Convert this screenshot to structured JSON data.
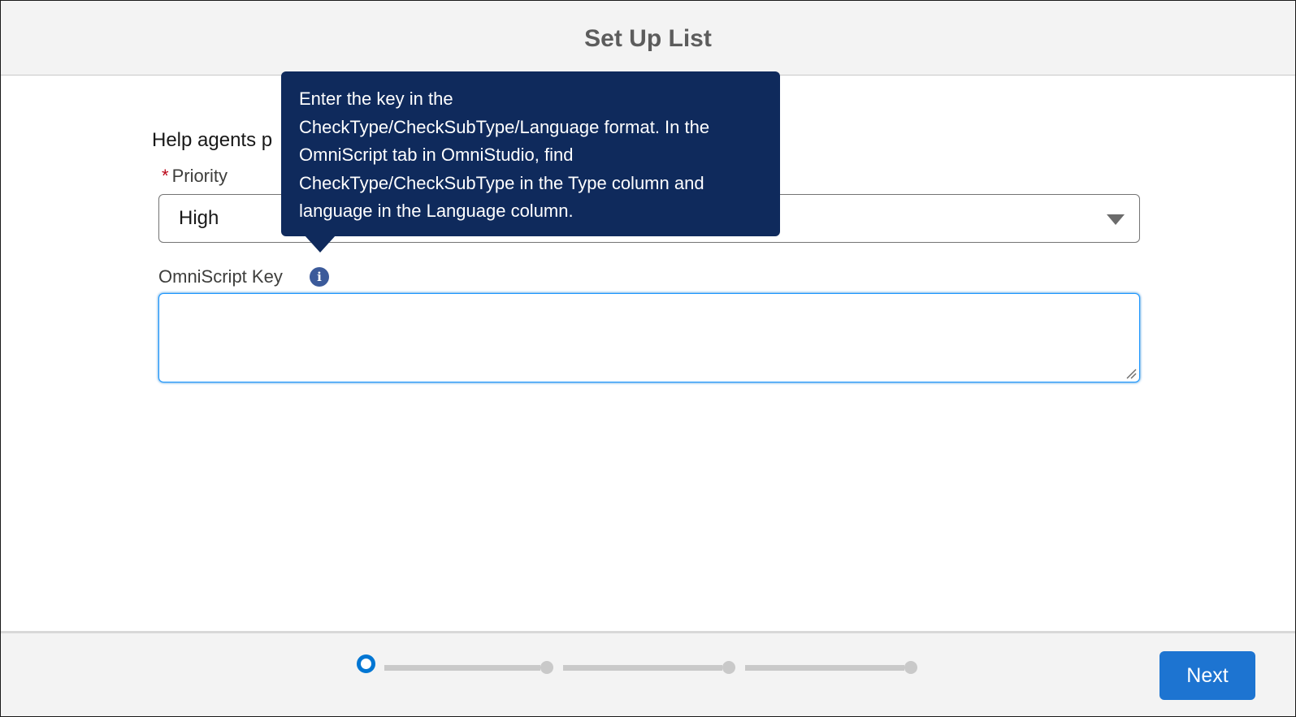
{
  "header": {
    "title": "Set Up List"
  },
  "form": {
    "help_text_visible": "Help agents p",
    "priority": {
      "required_marker": "*",
      "label": "Priority",
      "selected_value": "High"
    },
    "omniscript_key": {
      "label": "OmniScript Key",
      "value": "",
      "placeholder": ""
    }
  },
  "tooltip": {
    "text": "Enter the key in the\nCheckType/CheckSubType/Language format. In the\nOmniScript tab in OmniStudio, find\nCheckType/CheckSubType in the Type column and\nlanguage in the Language column."
  },
  "footer": {
    "progress": {
      "total_steps": 4,
      "current_step": 1
    },
    "next_label": "Next"
  },
  "colors": {
    "accent": "#0176d3",
    "tooltip_bg": "#0f2a5c",
    "required": "#ba0517",
    "button_bg": "#1d74d1"
  },
  "icons": {
    "info": "info-icon",
    "dropdown": "chevron-down-icon",
    "resize": "resize-grip-icon"
  }
}
